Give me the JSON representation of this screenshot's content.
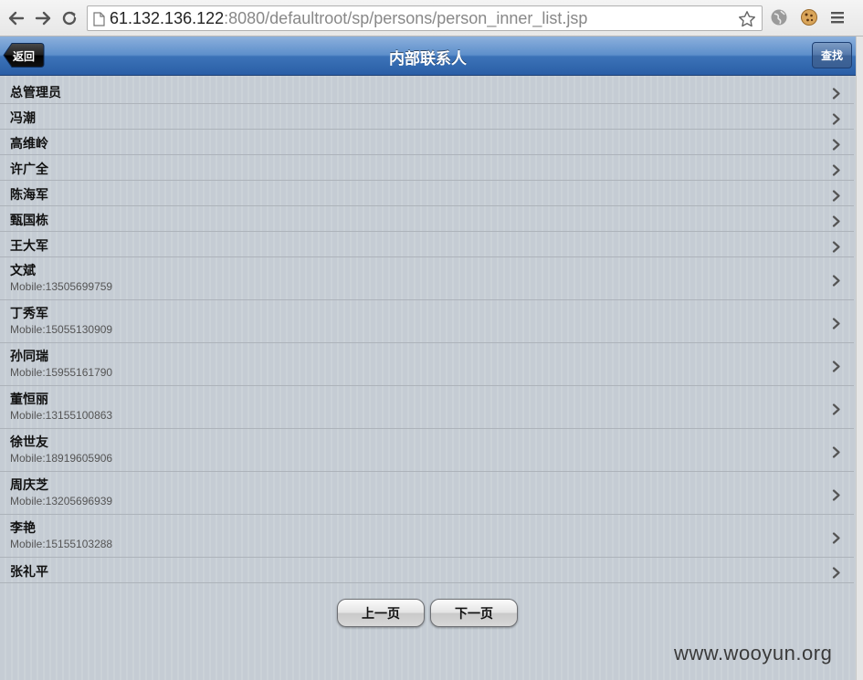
{
  "browser": {
    "url_host": "61.132.136.122",
    "url_rest": ":8080/defaultroot/sp/persons/person_inner_list.jsp",
    "icons": [
      "back-arrow-icon",
      "forward-arrow-icon",
      "reload-icon",
      "page-icon",
      "star-icon",
      "globe-icon",
      "cookie-icon",
      "menu-icon"
    ]
  },
  "header": {
    "title": "内部联系人",
    "back_label": "返回",
    "search_label": "查找",
    "color": "#3c73b8"
  },
  "contacts": [
    {
      "name": "总管理员",
      "mobile": ""
    },
    {
      "name": "冯潮",
      "mobile": ""
    },
    {
      "name": "高维岭",
      "mobile": ""
    },
    {
      "name": "许广全",
      "mobile": ""
    },
    {
      "name": "陈海军",
      "mobile": ""
    },
    {
      "name": "甄国栋",
      "mobile": ""
    },
    {
      "name": "王大军",
      "mobile": ""
    },
    {
      "name": "文斌",
      "mobile": "Mobile:13505699759"
    },
    {
      "name": "丁秀军",
      "mobile": "Mobile:15055130909"
    },
    {
      "name": "孙同瑞",
      "mobile": "Mobile:15955161790"
    },
    {
      "name": "董恒丽",
      "mobile": "Mobile:13155100863"
    },
    {
      "name": "徐世友",
      "mobile": "Mobile:18919605906"
    },
    {
      "name": "周庆芝",
      "mobile": "Mobile:13205696939"
    },
    {
      "name": "李艳",
      "mobile": "Mobile:15155103288"
    },
    {
      "name": "张礼平",
      "mobile": ""
    }
  ],
  "pager": {
    "prev_label": "上一页",
    "next_label": "下一页"
  },
  "watermark": "www.wooyun.org"
}
